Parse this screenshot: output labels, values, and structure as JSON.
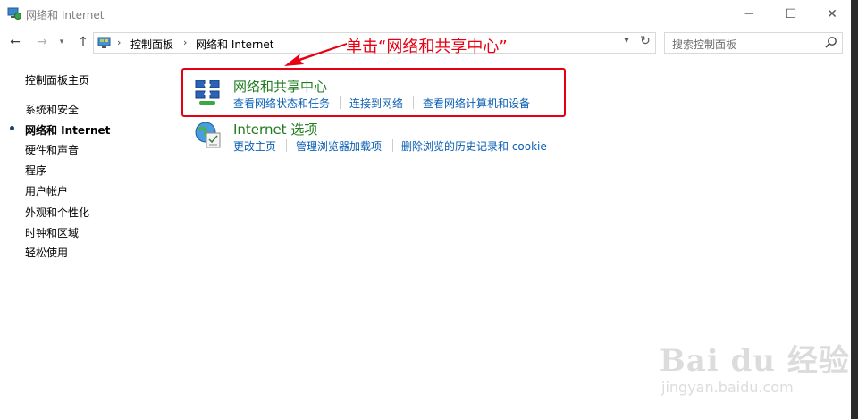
{
  "window": {
    "title": "网络和 Internet",
    "minimize": "─",
    "maximize": "☐",
    "close": "✕"
  },
  "nav": {
    "back": "←",
    "forward": "→",
    "recent": "▾",
    "up": "↑",
    "breadcrumb": [
      "控制面板",
      "网络和 Internet"
    ],
    "separator": "›",
    "dropdown": "▾",
    "refresh": "↻"
  },
  "search": {
    "placeholder": "搜索控制面板"
  },
  "sidebar": {
    "items": [
      {
        "label": "控制面板主页"
      },
      {
        "label": "系统和安全"
      },
      {
        "label": "网络和 Internet",
        "active": true
      },
      {
        "label": "硬件和声音"
      },
      {
        "label": "程序"
      },
      {
        "label": "用户帐户"
      },
      {
        "label": "外观和个性化"
      },
      {
        "label": "时钟和区域"
      },
      {
        "label": "轻松使用"
      }
    ]
  },
  "categories": [
    {
      "title": "网络和共享中心",
      "links": [
        "查看网络状态和任务",
        "连接到网络",
        "查看网络计算机和设备"
      ]
    },
    {
      "title": "Internet 选项",
      "links": [
        "更改主页",
        "管理浏览器加载项",
        "删除浏览的历史记录和 cookie"
      ]
    }
  ],
  "annotation": {
    "text": "单击“网络和共享中心”",
    "color": "#e60012"
  },
  "watermark": {
    "brand": "Bai du 经验",
    "url": "jingyan.baidu.com"
  },
  "colors": {
    "category_title": "#1e7b1e",
    "link": "#0a5fb4",
    "highlight": "#e60012"
  }
}
